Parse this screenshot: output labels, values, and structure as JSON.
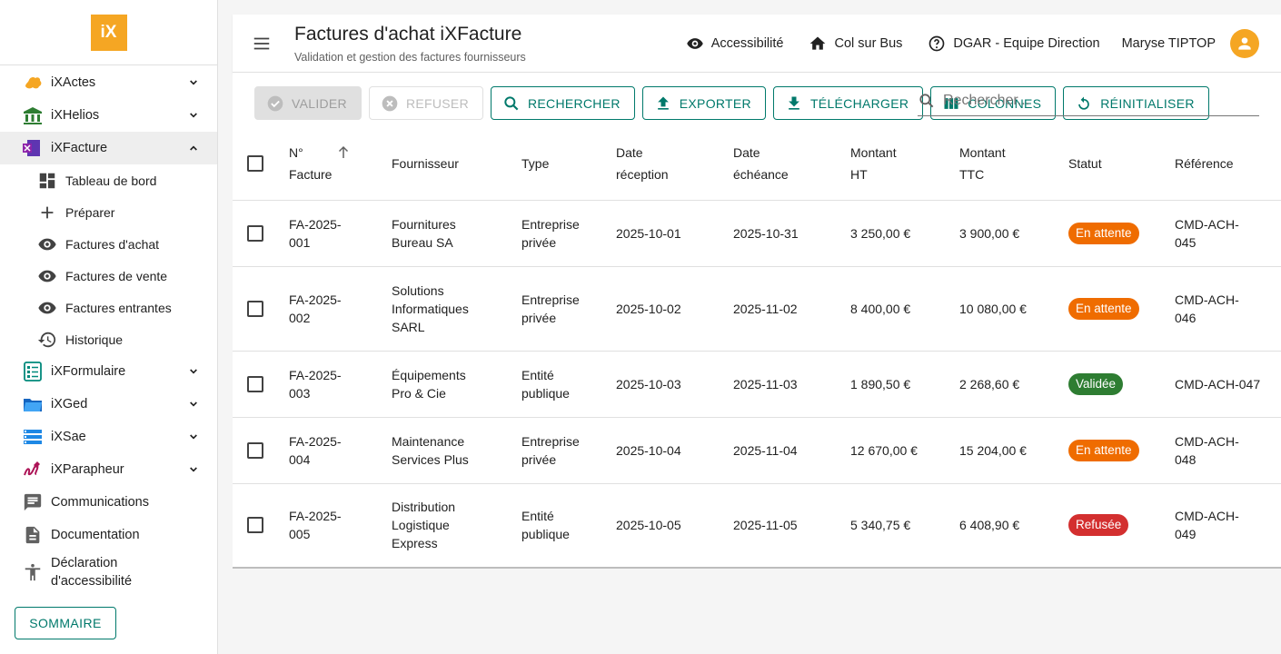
{
  "app": {
    "logo": "iX"
  },
  "sidebar": {
    "modules": [
      {
        "label": "iXActes",
        "icon": "ixactes-icon",
        "expanded": false
      },
      {
        "label": "iXHelios",
        "icon": "ixhelios-icon",
        "expanded": false
      },
      {
        "label": "iXFacture",
        "icon": "ixfacture-icon",
        "expanded": true
      }
    ],
    "facture_sub": [
      {
        "label": "Tableau de bord",
        "icon": "dashboard-icon"
      },
      {
        "label": "Préparer",
        "icon": "plus-icon"
      },
      {
        "label": "Factures d'achat",
        "icon": "eye-icon"
      },
      {
        "label": "Factures de vente",
        "icon": "eye-icon"
      },
      {
        "label": "Factures entrantes",
        "icon": "eye-icon"
      },
      {
        "label": "Historique",
        "icon": "history-icon"
      }
    ],
    "modules2": [
      {
        "label": "iXFormulaire",
        "icon": "ixformulaire-icon"
      },
      {
        "label": "iXGed",
        "icon": "ixged-icon"
      },
      {
        "label": "iXSae",
        "icon": "ixsae-icon"
      },
      {
        "label": "iXParapheur",
        "icon": "ixparapheur-icon"
      }
    ],
    "links": [
      {
        "label": "Communications",
        "icon": "chat-icon"
      },
      {
        "label": "Documentation",
        "icon": "document-icon"
      },
      {
        "label": "Déclaration d'accessibilité",
        "icon": "accessibility-icon"
      }
    ],
    "sommaire_label": "SOMMAIRE"
  },
  "header": {
    "title": "Factures d'achat iXFacture",
    "subtitle": "Validation et gestion des factures fournisseurs",
    "accessibility": "Accessibilité",
    "home": "Col sur Bus",
    "help": "DGAR - Equipe Direction",
    "user": "Maryse TIPTOP"
  },
  "toolbar": {
    "valider": "VALIDER",
    "refuser": "REFUSER",
    "rechercher": "RECHERCHER",
    "exporter": "EXPORTER",
    "telecharger": "TÉLÉCHARGER",
    "colonnes": "COLONNES",
    "reinitialiser": "RÉINITIALISER",
    "search_placeholder": "Rechercher..."
  },
  "table": {
    "headers": {
      "numero": [
        "N°",
        "Facture"
      ],
      "fournisseur": "Fournisseur",
      "type": "Type",
      "date_reception": [
        "Date",
        "réception"
      ],
      "date_echeance": [
        "Date",
        "échéance"
      ],
      "montant_ht": [
        "Montant",
        "HT"
      ],
      "montant_ttc": [
        "Montant",
        "TTC"
      ],
      "statut": "Statut",
      "reference": "Référence"
    },
    "rows": [
      {
        "numero": [
          "FA-2025-",
          "001"
        ],
        "fournisseur": [
          "Fournitures",
          "Bureau SA"
        ],
        "type": [
          "Entreprise",
          "privée"
        ],
        "reception": "2025-10-01",
        "echeance": "2025-10-31",
        "ht": "3 250,00 €",
        "ttc": "3 900,00 €",
        "statut": "En attente",
        "statut_kind": "pending",
        "reference": [
          "CMD-ACH-",
          "045"
        ]
      },
      {
        "numero": [
          "FA-2025-",
          "002"
        ],
        "fournisseur": [
          "Solutions",
          "Informatiques",
          "SARL"
        ],
        "type": [
          "Entreprise",
          "privée"
        ],
        "reception": "2025-10-02",
        "echeance": "2025-11-02",
        "ht": "8 400,00 €",
        "ttc": "10 080,00 €",
        "statut": "En attente",
        "statut_kind": "pending",
        "reference": [
          "CMD-ACH-",
          "046"
        ]
      },
      {
        "numero": [
          "FA-2025-",
          "003"
        ],
        "fournisseur": [
          "Équipements",
          "Pro & Cie"
        ],
        "type": [
          "Entité",
          "publique"
        ],
        "reception": "2025-10-03",
        "echeance": "2025-11-03",
        "ht": "1 890,50 €",
        "ttc": "2 268,60 €",
        "statut": "Validée",
        "statut_kind": "valid",
        "reference": [
          "CMD-ACH-047"
        ]
      },
      {
        "numero": [
          "FA-2025-",
          "004"
        ],
        "fournisseur": [
          "Maintenance",
          "Services Plus"
        ],
        "type": [
          "Entreprise",
          "privée"
        ],
        "reception": "2025-10-04",
        "echeance": "2025-11-04",
        "ht": "12 670,00 €",
        "ttc": "15 204,00 €",
        "statut": "En attente",
        "statut_kind": "pending",
        "reference": [
          "CMD-ACH-",
          "048"
        ]
      },
      {
        "numero": [
          "FA-2025-",
          "005"
        ],
        "fournisseur": [
          "Distribution",
          "Logistique",
          "Express"
        ],
        "type": [
          "Entité",
          "publique"
        ],
        "reception": "2025-10-05",
        "echeance": "2025-11-05",
        "ht": "5 340,75 €",
        "ttc": "6 408,90 €",
        "statut": "Refusée",
        "statut_kind": "refused",
        "reference": [
          "CMD-ACH-",
          "049"
        ]
      }
    ]
  }
}
